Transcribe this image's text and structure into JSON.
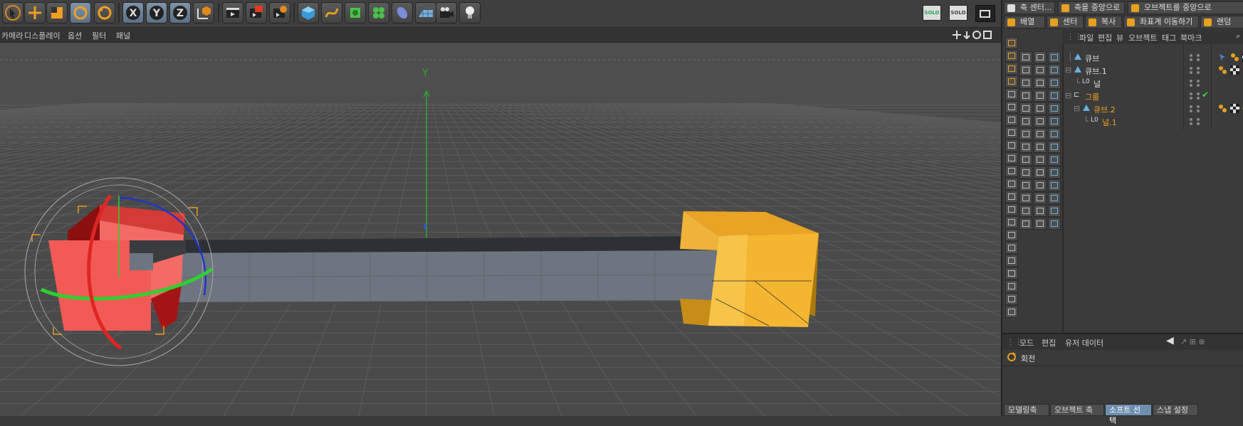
{
  "viewport_menu": [
    "카메라",
    "디스플레이",
    "옵션",
    "필터",
    "패널"
  ],
  "viewport_axis_label": "Y",
  "toolbar_icons": [
    "select-arrow-icon",
    "move-icon",
    "scale-icon",
    "rotate-icon",
    "rotate-alt-icon",
    "x-axis-icon",
    "y-axis-icon",
    "z-axis-icon",
    "coordinate-system-icon",
    "render-view-icon",
    "render-picture-viewer-icon",
    "render-settings-icon",
    "cube-icon",
    "spline-pen-icon",
    "nurbs-icon",
    "cloner-icon",
    "deformer-icon",
    "floor-icon",
    "camera-icon",
    "light-icon"
  ],
  "solo_label": "SOLO",
  "right_top_buttons": {
    "row1": [
      "축 센터...",
      "축을 중앙으로",
      "오브젝트를 중앙으로"
    ],
    "row2": [
      "배열",
      "센터",
      "복사",
      "좌표계 이동하기",
      "랜덤"
    ]
  },
  "object_manager": {
    "menu": [
      "파일",
      "편집",
      "뷰",
      "오브젝트",
      "태그",
      "북마크"
    ],
    "rows": [
      {
        "name": "큐브",
        "selected": false
      },
      {
        "name": "큐브.1",
        "selected": false
      },
      {
        "name": "널",
        "selected": false
      },
      {
        "name": "그룹",
        "selected": true
      },
      {
        "name": "큐브.2",
        "selected": true
      },
      {
        "name": "널.1",
        "selected": true
      }
    ]
  },
  "attribute_manager": {
    "menu": [
      "모드",
      "편집",
      "유저 데이터"
    ],
    "title": "회전",
    "modes": [
      "모델링축",
      "오브젝트 축",
      "소프트 선택",
      "스냅 설정"
    ],
    "selected_mode": "소프트 선택"
  },
  "colors": {
    "accent_orange": "#e8a020",
    "selection_blue": "#6f8fb0",
    "red_cube": "#f25a55",
    "yellow_cube": "#f4b432",
    "beam": "#6b7480"
  }
}
